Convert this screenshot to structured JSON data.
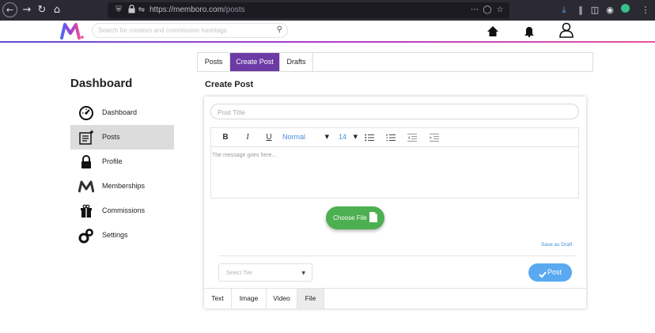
{
  "browser": {
    "url_host": "https://memboro.com",
    "url_path": "/posts"
  },
  "header": {
    "search_placeholder": "Search for creators and commission hashtags"
  },
  "sidebar": {
    "title": "Dashboard",
    "items": [
      {
        "label": "Dashboard",
        "icon": "speedometer-icon"
      },
      {
        "label": "Posts",
        "icon": "posts-icon",
        "active": true
      },
      {
        "label": "Profile",
        "icon": "lock-icon"
      },
      {
        "label": "Memberships",
        "icon": "memboro-m-icon"
      },
      {
        "label": "Commissions",
        "icon": "gift-icon"
      },
      {
        "label": "Settings",
        "icon": "gears-icon"
      }
    ]
  },
  "top_tabs": [
    {
      "label": "Posts"
    },
    {
      "label": "Create Post",
      "active": true
    },
    {
      "label": "Drafts"
    }
  ],
  "editor": {
    "heading": "Create Post",
    "title_placeholder": "Post Title",
    "toolbar": {
      "bold": "B",
      "italic": "I",
      "underline": "U",
      "style": "Normal",
      "size": "14"
    },
    "message_placeholder": "The message goes here...",
    "choose_file_label": "Choose File",
    "save_draft_label": "Save as Draft",
    "tier_placeholder": "Select Tier",
    "post_label": "Post"
  },
  "bottom_tabs": [
    {
      "label": "Text"
    },
    {
      "label": "Image"
    },
    {
      "label": "Video"
    },
    {
      "label": "File",
      "active": true
    }
  ],
  "colors": {
    "accent_purple": "#6c3ba5",
    "choose_file_green": "#4caf50",
    "post_blue": "#5aa9f0",
    "link_blue": "#3f8fd6"
  }
}
